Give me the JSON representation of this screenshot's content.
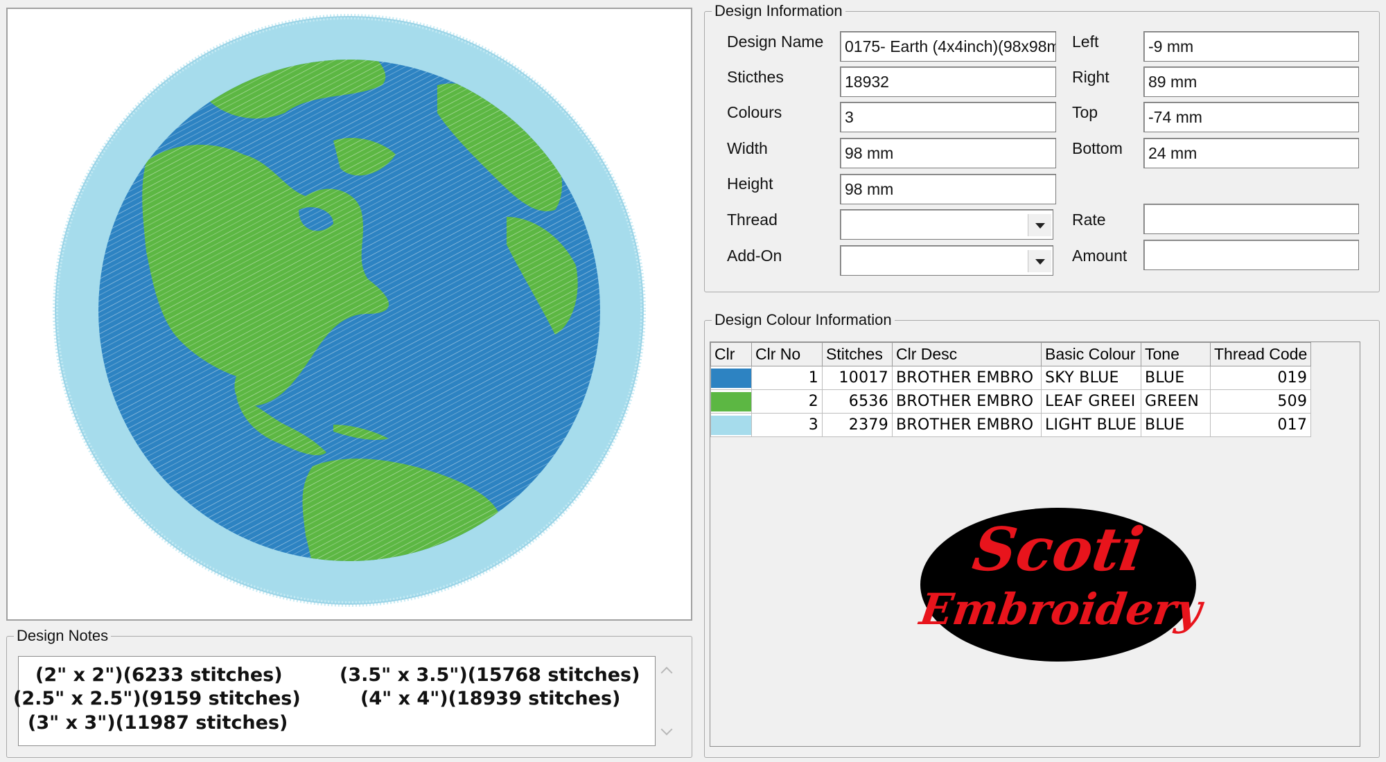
{
  "design_info": {
    "legend": "Design Information",
    "design_name_label": "Design Name",
    "design_name": "0175- Earth (4x4inch)(98x98m",
    "stitches_label": "Sticthes",
    "stitches": "18932",
    "colours_label": "Colours",
    "colours": "3",
    "width_label": "Width",
    "width": "98 mm",
    "height_label": "Height",
    "height": "98 mm",
    "thread_label": "Thread",
    "thread": "",
    "addon_label": "Add-On",
    "addon": "",
    "left_label": "Left",
    "left": "-9 mm",
    "right_label": "Right",
    "right": "89 mm",
    "top_label": "Top",
    "top": "-74 mm",
    "bottom_label": "Bottom",
    "bottom": "24 mm",
    "rate_label": "Rate",
    "rate": "",
    "amount_label": "Amount",
    "amount": ""
  },
  "colour_info": {
    "legend": "Design Colour Information",
    "columns": [
      "Clr",
      "Clr No",
      "Stitches",
      "Clr Desc",
      "Basic Colour",
      "Tone",
      "Thread Code"
    ],
    "rows": [
      {
        "clr_no": "1",
        "stitches": "10017",
        "desc": "BROTHER EMBRO",
        "basic": "SKY BLUE",
        "tone": "BLUE",
        "code": "019",
        "color": "#2d83c2"
      },
      {
        "clr_no": "2",
        "stitches": "6536",
        "desc": "BROTHER EMBRO",
        "basic": "LEAF GREEI",
        "tone": "GREEN",
        "code": "509",
        "color": "#5cb743"
      },
      {
        "clr_no": "3",
        "stitches": "2379",
        "desc": "BROTHER EMBRO",
        "basic": "LIGHT BLUE",
        "tone": "BLUE",
        "code": "017",
        "color": "#a6dcec"
      }
    ]
  },
  "logo": {
    "line1": "Scoti",
    "line2": "Embroidery",
    "bg": "#000000",
    "fg": "#e8141c"
  },
  "notes": {
    "legend": "Design Notes",
    "items": [
      "(2\" x 2\")(6233 stitches)",
      "(3.5\" x 3.5\")(15768 stitches)",
      "(2.5\" x 2.5\")(9159 stitches)",
      "(4\" x 4\")(18939 stitches)",
      "(3\" x 3\")(11987 stitches)"
    ]
  },
  "preview": {
    "ocean": "#2d83c2",
    "land": "#5cb743",
    "rim": "#a6dcec"
  }
}
